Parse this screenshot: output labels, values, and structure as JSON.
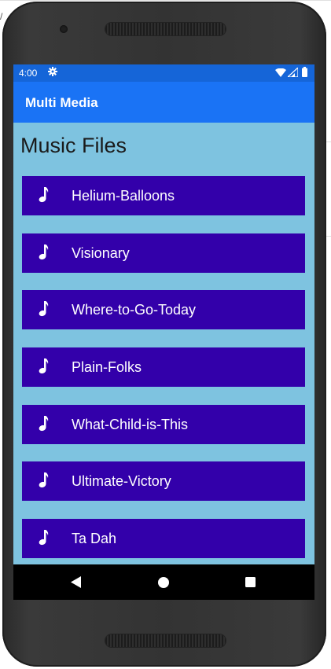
{
  "status_bar": {
    "time": "4:00",
    "icons": [
      "gear-icon",
      "wifi-icon",
      "signal-icon",
      "battery-icon"
    ]
  },
  "app_bar": {
    "title": "Multi Media"
  },
  "page": {
    "title": "Music Files"
  },
  "tracks": [
    {
      "label": "Helium-Balloons",
      "icon": "music-note-icon"
    },
    {
      "label": "Visionary",
      "icon": "music-note-icon"
    },
    {
      "label": "Where-to-Go-Today",
      "icon": "music-note-icon"
    },
    {
      "label": "Plain-Folks",
      "icon": "music-note-icon"
    },
    {
      "label": "What-Child-is-This",
      "icon": "music-note-icon"
    },
    {
      "label": "Ultimate-Victory",
      "icon": "music-note-icon"
    },
    {
      "label": "Ta Dah",
      "icon": "music-note-icon"
    }
  ],
  "nav_bar": {
    "icons": [
      "back-icon",
      "home-icon",
      "recents-icon"
    ]
  },
  "colors": {
    "status_bar": "#1565d8",
    "app_bar": "#1a73f5",
    "background": "#7ec3e0",
    "track_item": "#3300aa",
    "nav_bar": "#000000"
  }
}
